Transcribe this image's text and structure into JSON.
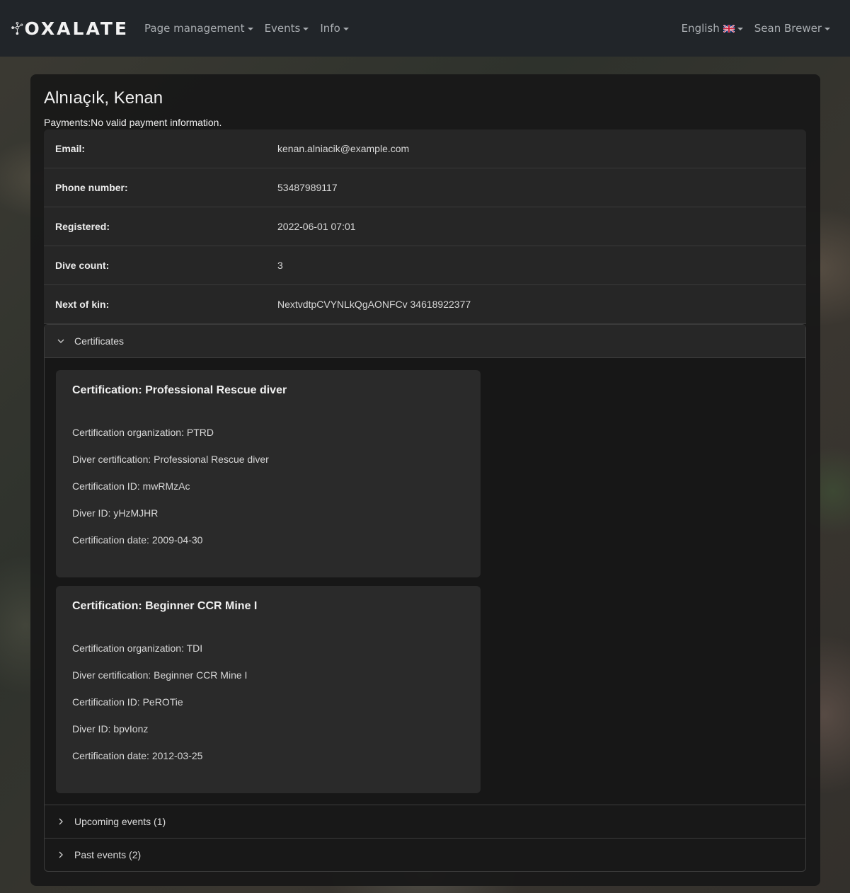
{
  "navbar": {
    "brand": "OXALATE",
    "left_menus": [
      "Page management",
      "Events",
      "Info"
    ],
    "language": "English",
    "user": "Sean Brewer"
  },
  "member": {
    "name": "Alnıaçık, Kenan",
    "payments_label": "Payments:",
    "payments_value": "No valid payment information.",
    "fields": [
      {
        "label": "Email:",
        "value": "kenan.alniacik@example.com"
      },
      {
        "label": "Phone number:",
        "value": "53487989117"
      },
      {
        "label": "Registered:",
        "value": "2022-06-01 07:01"
      },
      {
        "label": "Dive count:",
        "value": "3"
      },
      {
        "label": "Next of kin:",
        "value": "NextvdtpCVYNLkQgAONFCv 34618922377"
      }
    ]
  },
  "accordion": {
    "certificates_label": "Certificates",
    "upcoming_label": "Upcoming events (1)",
    "past_label": "Past events (2)"
  },
  "certificates": [
    {
      "title": "Certification: Professional Rescue diver",
      "lines": [
        "Certification organization: PTRD",
        "Diver certification: Professional Rescue diver",
        "Certification ID: mwRMzAc",
        "Diver ID: yHzMJHR",
        "Certification date: 2009-04-30"
      ]
    },
    {
      "title": "Certification: Beginner CCR Mine I",
      "lines": [
        "Certification organization: TDI",
        "Diver certification: Beginner CCR Mine I",
        "Certification ID: PeROTie",
        "Diver ID: bpvIonz",
        "Certification date: 2012-03-25"
      ]
    }
  ],
  "colors": {
    "navbar_bg": "#212529",
    "card_bg": "#181818",
    "cert_card_bg": "#2a2a2a"
  }
}
